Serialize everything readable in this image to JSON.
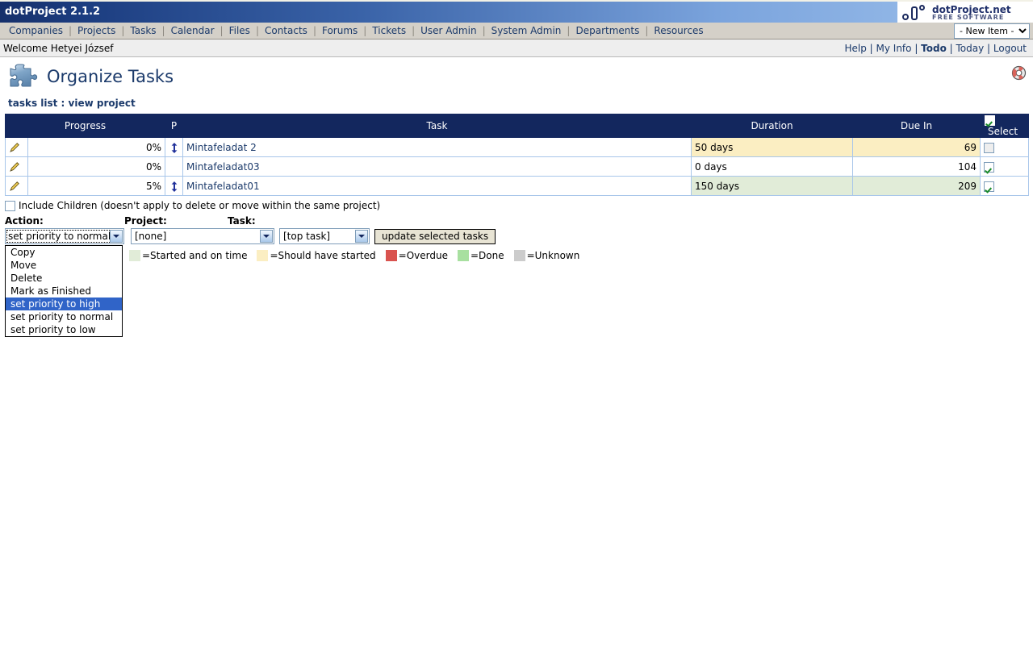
{
  "app": {
    "title": "dotProject 2.1.2",
    "brand_name": "dotProject.net",
    "brand_tagline": "FREE SOFTWARE"
  },
  "nav": {
    "items": [
      {
        "label": "Companies"
      },
      {
        "label": "Projects"
      },
      {
        "label": "Tasks"
      },
      {
        "label": "Calendar"
      },
      {
        "label": "Files"
      },
      {
        "label": "Contacts"
      },
      {
        "label": "Forums"
      },
      {
        "label": "Tickets"
      },
      {
        "label": "User Admin"
      },
      {
        "label": "System Admin"
      },
      {
        "label": "Departments"
      },
      {
        "label": "Resources"
      }
    ],
    "new_item_select": "- New Item -"
  },
  "welcome": {
    "text": "Welcome Hetyei József",
    "links": [
      {
        "label": "Help",
        "bold": false
      },
      {
        "label": "My Info",
        "bold": false
      },
      {
        "label": "Todo",
        "bold": true
      },
      {
        "label": "Today",
        "bold": false
      },
      {
        "label": "Logout",
        "bold": false
      }
    ]
  },
  "page": {
    "title": "Organize Tasks",
    "breadcrumb": "tasks list : view project",
    "help_icon": "lifering-icon",
    "title_icon": "puzzle-piece-icon"
  },
  "table": {
    "headers": {
      "progress": "Progress",
      "priority": "P",
      "task": "Task",
      "duration": "Duration",
      "due_in": "Due In",
      "select": "Select"
    },
    "select_all_checked": true,
    "rows": [
      {
        "edit_icon": "pencil-icon",
        "progress": "0%",
        "priority_icon": "priority-up-arrow-icon",
        "has_priority": true,
        "task": "Mintafeladat 2",
        "duration": "50 days",
        "due_in": "69",
        "selected": false,
        "status_color": "yellow"
      },
      {
        "edit_icon": "pencil-icon",
        "progress": "0%",
        "priority_icon": "",
        "has_priority": false,
        "task": "Mintafeladat03",
        "duration": "0 days",
        "due_in": "104",
        "selected": true,
        "status_color": "white"
      },
      {
        "edit_icon": "pencil-icon",
        "progress": "5%",
        "priority_icon": "priority-up-arrow-icon",
        "has_priority": true,
        "task": "Mintafeladat01",
        "duration": "150 days",
        "due_in": "209",
        "selected": true,
        "status_color": "green"
      }
    ]
  },
  "actions": {
    "include_children_label": "Include Children (doesn't apply to delete or move within the same project)",
    "include_children_checked": false,
    "label_action": "Action:",
    "label_project": "Project:",
    "label_task": "Task:",
    "action_value": "set priority to normal",
    "project_value": "[none]",
    "task_value": "[top task]",
    "update_button": "update selected tasks",
    "action_options": [
      {
        "label": "Copy",
        "selected": false
      },
      {
        "label": "Move",
        "selected": false
      },
      {
        "label": "Delete",
        "selected": false
      },
      {
        "label": "Mark as Finished",
        "selected": false
      },
      {
        "label": "set priority to high",
        "selected": true
      },
      {
        "label": "set priority to normal",
        "selected": false
      },
      {
        "label": "set priority to low",
        "selected": false
      }
    ],
    "dropdown_open": true
  },
  "legend": {
    "items": [
      {
        "color": "#e1ecd8",
        "label": "=Started and on time"
      },
      {
        "color": "#fbeec2",
        "label": "=Should have started"
      },
      {
        "color": "#d9534f",
        "label": "=Overdue"
      },
      {
        "color": "#a8e0a0",
        "label": "=Done"
      },
      {
        "color": "#cccccc",
        "label": "=Unknown"
      }
    ]
  },
  "colors": {
    "header_blue": "#13275e",
    "link_blue": "#1b3a6b",
    "nav_bg": "#d4d0c8",
    "highlight_blue": "#3064c8"
  }
}
